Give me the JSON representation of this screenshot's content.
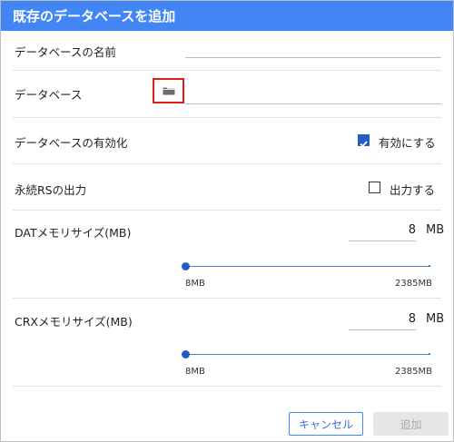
{
  "dialog": {
    "title": "既存のデータベースを追加",
    "accent_color": "#4285f4"
  },
  "fields": {
    "db_name": {
      "label": "データベースの名前",
      "value": ""
    },
    "db_path": {
      "label": "データベース",
      "value": "",
      "browse_icon": "folder-icon"
    },
    "enable_db": {
      "label": "データベースの有効化",
      "checkbox_label": "有効にする",
      "checked": true
    },
    "persist_rs": {
      "label": "永続RSの出力",
      "checkbox_label": "出力する",
      "checked": false
    },
    "dat_memory": {
      "label": "DATメモリサイズ(MB)",
      "value": "8",
      "unit": "MB",
      "slider_min_label": "8MB",
      "slider_max_label": "2385MB",
      "slider_fraction": 0.0
    },
    "crx_memory": {
      "label": "CRXメモリサイズ(MB)",
      "value": "8",
      "unit": "MB",
      "slider_min_label": "8MB",
      "slider_max_label": "2385MB",
      "slider_fraction": 0.0
    }
  },
  "buttons": {
    "cancel": "キャンセル",
    "add": "追加"
  }
}
